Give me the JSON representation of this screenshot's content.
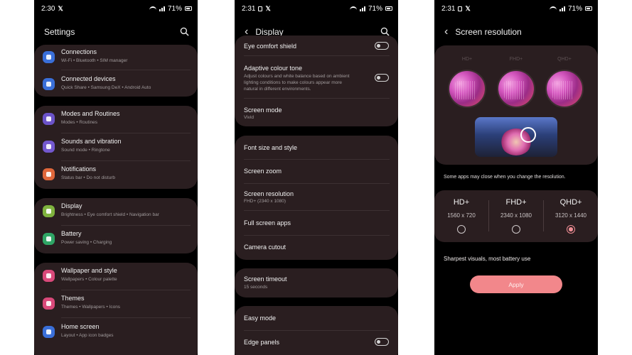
{
  "screen1": {
    "time": "2:30",
    "battery": "71%",
    "title": "Settings",
    "groups": [
      {
        "items": [
          {
            "title": "Connections",
            "subtitle": "Wi-Fi • Bluetooth • SIM manager",
            "icon": "wifi-icon",
            "color": "#3a6fd9"
          },
          {
            "title": "Connected devices",
            "subtitle": "Quick Share • Samsung DeX • Android Auto",
            "icon": "connected-devices-icon",
            "color": "#3a6fd9"
          }
        ]
      },
      {
        "items": [
          {
            "title": "Modes and Routines",
            "subtitle": "Modes • Routines",
            "icon": "modes-icon",
            "color": "#6b53c9"
          },
          {
            "title": "Sounds and vibration",
            "subtitle": "Sound mode • Ringtone",
            "icon": "sound-icon",
            "color": "#7358cf"
          },
          {
            "title": "Notifications",
            "subtitle": "Status bar • Do not disturb",
            "icon": "notification-icon",
            "color": "#e0673b"
          }
        ]
      },
      {
        "items": [
          {
            "title": "Display",
            "subtitle": "Brightness • Eye comfort shield • Navigation bar",
            "icon": "display-icon",
            "color": "#7fb33e"
          },
          {
            "title": "Battery",
            "subtitle": "Power saving • Charging",
            "icon": "battery-icon",
            "color": "#2fa565"
          }
        ]
      },
      {
        "items": [
          {
            "title": "Wallpaper and style",
            "subtitle": "Wallpapers • Colour palette",
            "icon": "wallpaper-icon",
            "color": "#d9497a"
          },
          {
            "title": "Themes",
            "subtitle": "Themes • Wallpapers • Icons",
            "icon": "themes-icon",
            "color": "#d9497a"
          },
          {
            "title": "Home screen",
            "subtitle": "Layout • App icon badges",
            "icon": "home-icon",
            "color": "#3a6fd9"
          }
        ]
      }
    ]
  },
  "screen2": {
    "time": "2:31",
    "battery": "71%",
    "title": "Display",
    "group1": {
      "eye_comfort": "Eye comfort shield",
      "adaptive_title": "Adaptive colour tone",
      "adaptive_l1": "Adjust colours and white balance based on ambient",
      "adaptive_l2": "lighting conditions to make colours appear more",
      "adaptive_l3": "natural in different environments.",
      "screen_mode": "Screen mode",
      "screen_mode_value": "Vivid"
    },
    "group2": {
      "font": "Font size and style",
      "zoom": "Screen zoom",
      "resolution": "Screen resolution",
      "resolution_value": "FHD+ (2340 x 1080)",
      "full_screen": "Full screen apps",
      "cutout": "Camera cutout"
    },
    "group3": {
      "timeout": "Screen timeout",
      "timeout_value": "15 seconds"
    },
    "group4": {
      "easy_mode": "Easy mode",
      "edge_panels": "Edge panels"
    }
  },
  "screen3": {
    "time": "2:31",
    "battery": "71%",
    "title": "Screen resolution",
    "preview_labels": [
      "HD+",
      "FHD+",
      "QHD+"
    ],
    "notice": "Some apps may close when you change the resolution.",
    "options": [
      {
        "name": "HD+",
        "size": "1560 x 720",
        "selected": false
      },
      {
        "name": "FHD+",
        "size": "2340 x 1080",
        "selected": false
      },
      {
        "name": "QHD+",
        "size": "3120 x 1440",
        "selected": true
      }
    ],
    "description": "Sharpest visuals, most battery use",
    "apply": "Apply"
  }
}
